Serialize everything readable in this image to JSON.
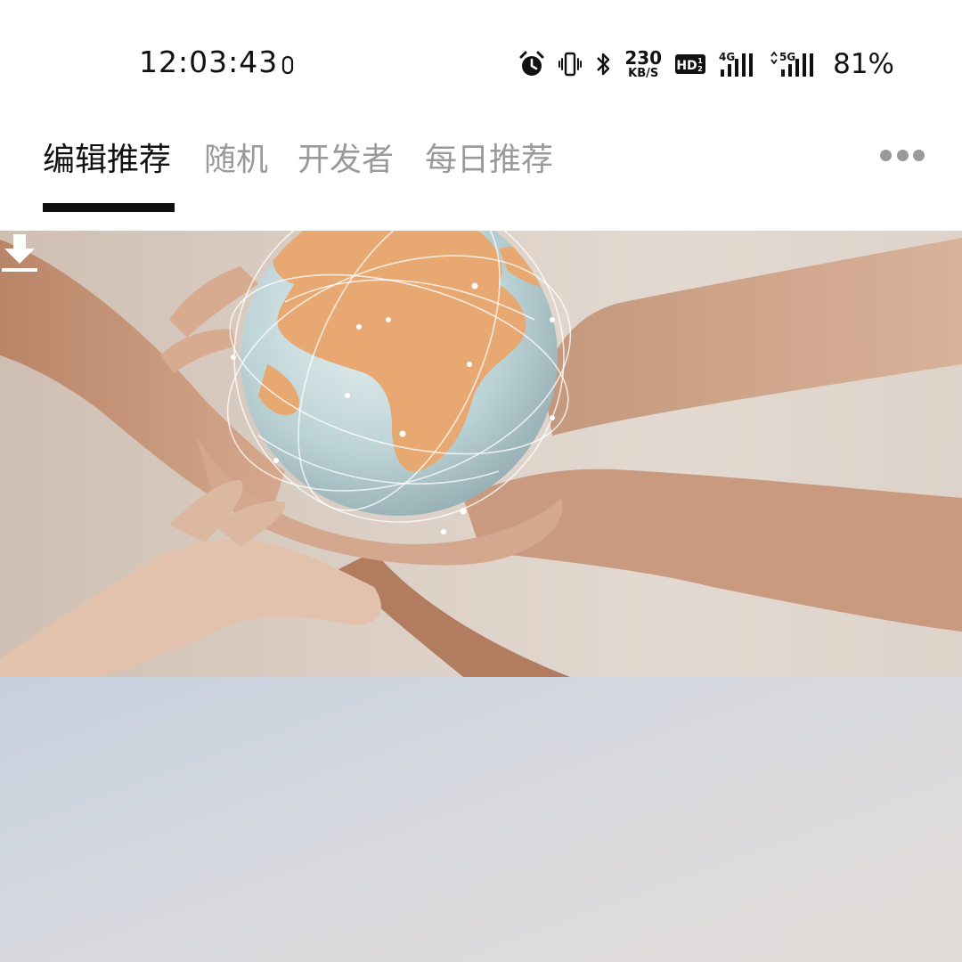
{
  "status_bar": {
    "time": "12:03:43",
    "net_speed": "230",
    "net_speed_unit": "KB/S",
    "hd_label": "HD",
    "signal1_label": "4G",
    "signal2_label": "5G",
    "battery": "81%",
    "icons": [
      "alarm-icon",
      "vibrate-icon",
      "bluetooth-icon",
      "hd-voice-icon",
      "signal-4g-icon",
      "signal-5g-icon"
    ]
  },
  "tabs": [
    {
      "label": "编辑推荐",
      "active": true
    },
    {
      "label": "随机",
      "active": false
    },
    {
      "label": "开发者",
      "active": false
    },
    {
      "label": "每日推荐",
      "active": false
    }
  ],
  "toolbar": {
    "more_icon": "more-dots-icon"
  },
  "feed": {
    "cards": [
      {
        "image": "hands-holding-globe",
        "action_icon": "download-icon"
      },
      {
        "image": "pale-gradient"
      }
    ]
  },
  "colors": {
    "active_tab": "#111111",
    "inactive_tab": "#9a9a9a",
    "indicator": "#111111"
  }
}
